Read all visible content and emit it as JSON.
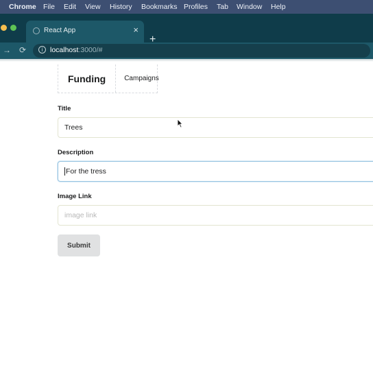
{
  "menubar": {
    "app": "Chrome",
    "items": [
      "File",
      "Edit",
      "View",
      "History",
      "Bookmarks",
      "Profiles",
      "Tab",
      "Window",
      "Help"
    ]
  },
  "browser": {
    "tab_title": "React App",
    "tab_close": "×",
    "new_tab": "+",
    "url_host": "localhost",
    "url_rest": ":3000/#"
  },
  "nav": {
    "brand": "Funding",
    "link": "Campaigns"
  },
  "form": {
    "title_label": "Title",
    "title_value": "Trees",
    "description_label": "Description",
    "description_value": "For the tress",
    "image_label": "Image Link",
    "image_placeholder": "image link",
    "submit_label": "Submit"
  },
  "colors": {
    "menubar": "#3d4f72",
    "tabstrip": "#0f3c4a",
    "tab_active": "#1d5868",
    "button": "#e0e1e2"
  }
}
